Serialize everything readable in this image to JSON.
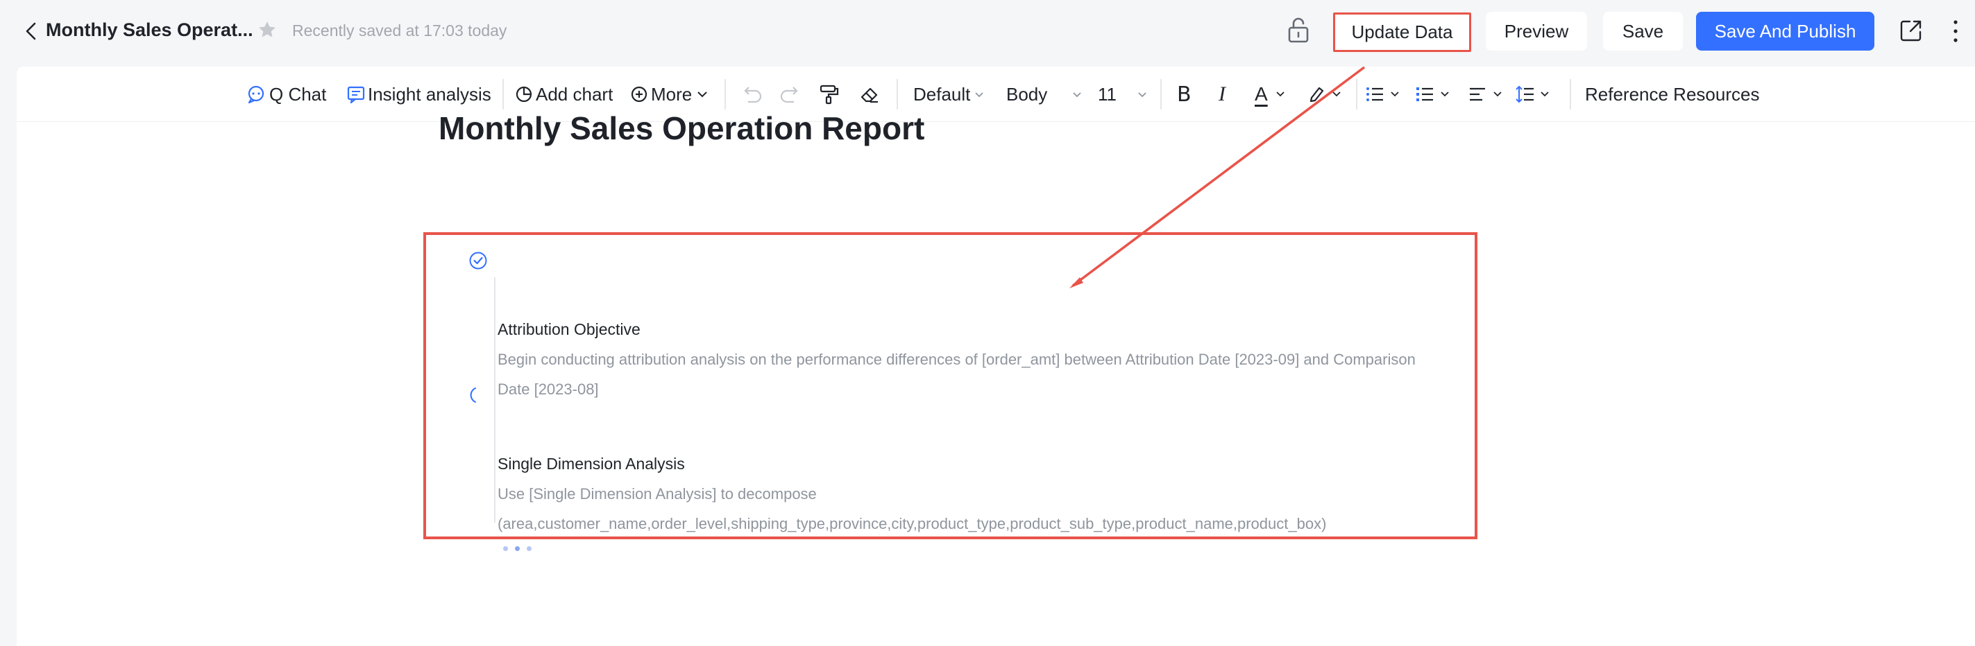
{
  "header": {
    "doc_title": "Monthly Sales Operat...",
    "save_status": "Recently saved at 17:03 today",
    "update_label": "Update Data",
    "preview_label": "Preview",
    "save_label": "Save",
    "publish_label": "Save And Publish",
    "accent_color": "#3370ff",
    "highlight_color": "#e8544a"
  },
  "toolbar": {
    "q_chat": "Q Chat",
    "insight": "Insight analysis",
    "add_chart": "Add chart",
    "more": "More",
    "font": "Default",
    "style": "Body",
    "size": "11",
    "bold": "B",
    "italic": "I",
    "font_color": "A",
    "reference": "Reference Resources"
  },
  "document": {
    "title": "Monthly Sales Operation Report",
    "steps": [
      {
        "title": "Attribution Objective",
        "status": "done",
        "desc_1": "Begin conducting attribution analysis on the performance differences of [order_amt] between Attribution Date [2023-09] and Comparison",
        "desc_2": "Date [2023-08]"
      },
      {
        "title": "Single Dimension Analysis",
        "status": "loading",
        "desc_1": "Use [Single Dimension Analysis] to decompose",
        "desc_2": "(area,customer_name,order_level,shipping_type,province,city,product_type,product_sub_type,product_name,product_box)"
      }
    ]
  }
}
